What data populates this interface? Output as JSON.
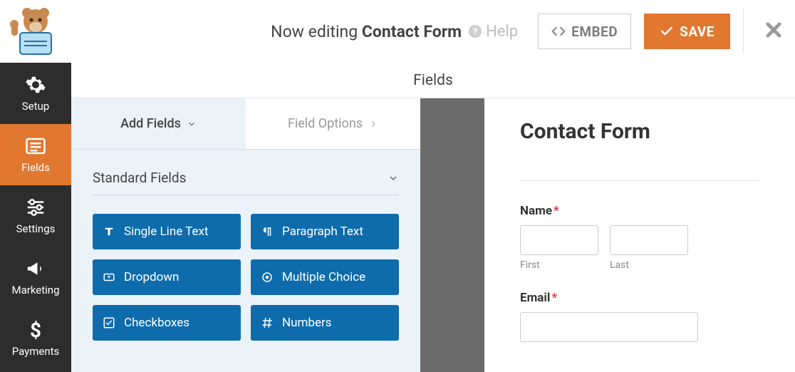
{
  "header": {
    "editing_prefix": "Now editing ",
    "form_name": "Contact Form",
    "help_label": "Help",
    "embed_label": "EMBED",
    "save_label": "SAVE"
  },
  "sidebar": {
    "items": [
      {
        "label": "Setup"
      },
      {
        "label": "Fields"
      },
      {
        "label": "Settings"
      },
      {
        "label": "Marketing"
      },
      {
        "label": "Payments"
      }
    ]
  },
  "panel": {
    "header": "Fields",
    "tabs": {
      "add": "Add Fields",
      "options": "Field Options"
    },
    "section_title": "Standard Fields",
    "fields": [
      {
        "label": "Single Line Text"
      },
      {
        "label": "Paragraph Text"
      },
      {
        "label": "Dropdown"
      },
      {
        "label": "Multiple Choice"
      },
      {
        "label": "Checkboxes"
      },
      {
        "label": "Numbers"
      }
    ]
  },
  "preview": {
    "title": "Contact Form",
    "name_label": "Name",
    "first_sub": "First",
    "last_sub": "Last",
    "email_label": "Email"
  }
}
